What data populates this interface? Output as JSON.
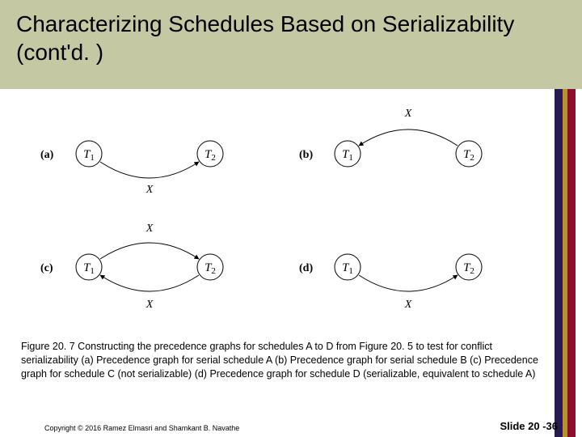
{
  "title": "Characterizing Schedules Based on Serializability (cont'd. )",
  "figure": {
    "parts": {
      "a": {
        "label": "(a)",
        "nodes": [
          "T1",
          "T2"
        ],
        "edges": [
          {
            "from": "T1",
            "to": "T2",
            "label": "X",
            "dir": "down"
          }
        ]
      },
      "b": {
        "label": "(b)",
        "nodes": [
          "T1",
          "T2"
        ],
        "edges": [
          {
            "from": "T2",
            "to": "T1",
            "label": "X",
            "dir": "up"
          }
        ]
      },
      "c": {
        "label": "(c)",
        "nodes": [
          "T1",
          "T2"
        ],
        "edges": [
          {
            "from": "T1",
            "to": "T2",
            "label": "X",
            "dir": "up"
          },
          {
            "from": "T2",
            "to": "T1",
            "label": "X",
            "dir": "down"
          }
        ]
      },
      "d": {
        "label": "(d)",
        "nodes": [
          "T1",
          "T2"
        ],
        "edges": [
          {
            "from": "T1",
            "to": "T2",
            "label": "X",
            "dir": "down"
          }
        ]
      }
    },
    "node_symbol": "T",
    "edge_symbol": "X"
  },
  "caption": "Figure 20. 7 Constructing the precedence graphs for schedules A to D from Figure 20. 5 to test for conflict serializability (a) Precedence graph for serial schedule A (b) Precedence graph for serial schedule B (c) Precedence graph for schedule C (not serializable) (d) Precedence graph for schedule D (serializable, equivalent to schedule A)",
  "copyright": "Copyright © 2016 Ramez Elmasri and Shamkant B. Navathe",
  "slidenum": "Slide 20 -36"
}
